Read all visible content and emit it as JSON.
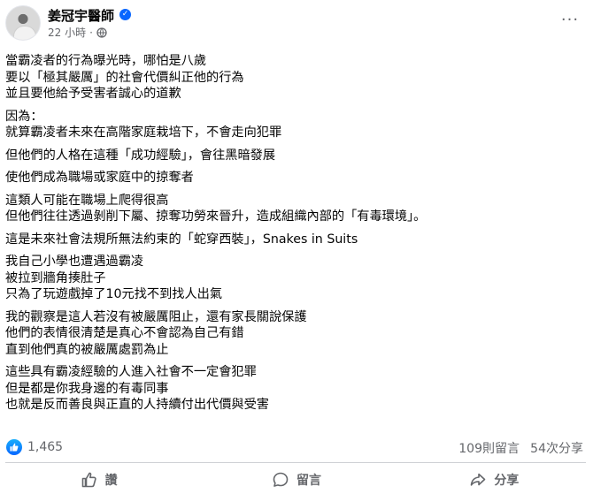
{
  "author": {
    "name": "姜冠宇醫師",
    "verified_icon": "verified-badge-icon",
    "time": "22 小時",
    "separator": "·",
    "audience_icon": "globe-icon"
  },
  "menu_label": "···",
  "post": {
    "paragraphs": [
      "當霸凌者的行為曝光時，哪怕是八歲\n要以「極其嚴厲」的社會代價糾正他的行為\n並且要他給予受害者誠心的道歉",
      "因為：\n就算霸凌者未來在高階家庭栽培下，不會走向犯罪",
      "但他們的人格在這種「成功經驗」，會往黑暗發展",
      "使他們成為職場或家庭中的掠奪者",
      "這類人可能在職場上爬得很高\n但他們往往透過剝削下屬、掠奪功勞來晉升，造成組織內部的「有毒環境」。",
      "這是未來社會法規所無法約束的「蛇穿西裝」，Snakes in Suits",
      "我自己小學也遭遇過霸凌\n被拉到牆角揍肚子\n只為了玩遊戲掉了10元找不到找人出氣",
      "我的觀察是這人若沒有被嚴厲阻止，還有家長關說保護\n他們的表情很清楚是真心不會認為自己有錯\n直到他們真的被嚴厲處罰為止",
      "這些具有霸凌經驗的人進入社會不一定會犯罪\n但是都是你我身邊的有毒同事\n也就是反而善良與正直的人持續付出代價與受害"
    ]
  },
  "stats": {
    "reaction_icon": "like-reaction-icon",
    "like_count": "1,465",
    "comments": "109則留言",
    "shares": "54次分享"
  },
  "actions": {
    "like": "讚",
    "comment": "留言",
    "share": "分享"
  },
  "colors": {
    "accent": "#0866ff",
    "secondary_text": "#65676b",
    "divider": "#ced0d4"
  }
}
